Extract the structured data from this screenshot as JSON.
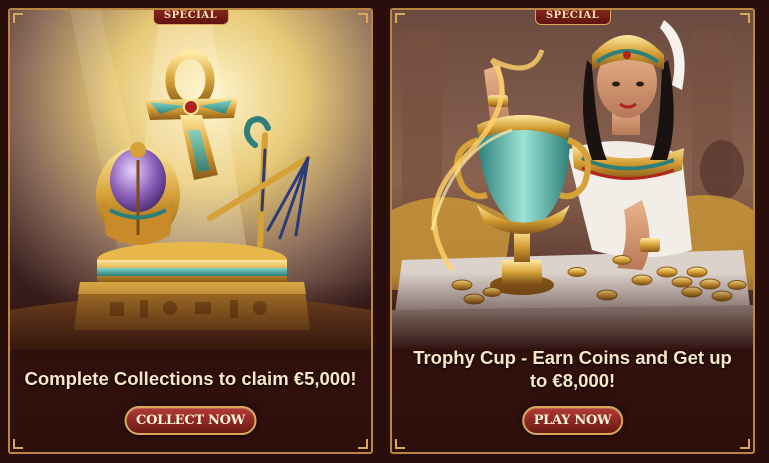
{
  "cards": [
    {
      "badge": "SPECIAL",
      "title": "Complete Collections to claim €5,000!",
      "button": "COLLECT NOW"
    },
    {
      "badge": "SPECIAL",
      "title": "Trophy Cup - Earn Coins and Get up to €8,000!",
      "button": "PLAY NOW"
    }
  ],
  "colors": {
    "background": "#2a0e0b",
    "frame": "#b9873f",
    "badge": "#7a1f1a",
    "button": "#8f2a22",
    "title_text": "#f7e7c7"
  }
}
